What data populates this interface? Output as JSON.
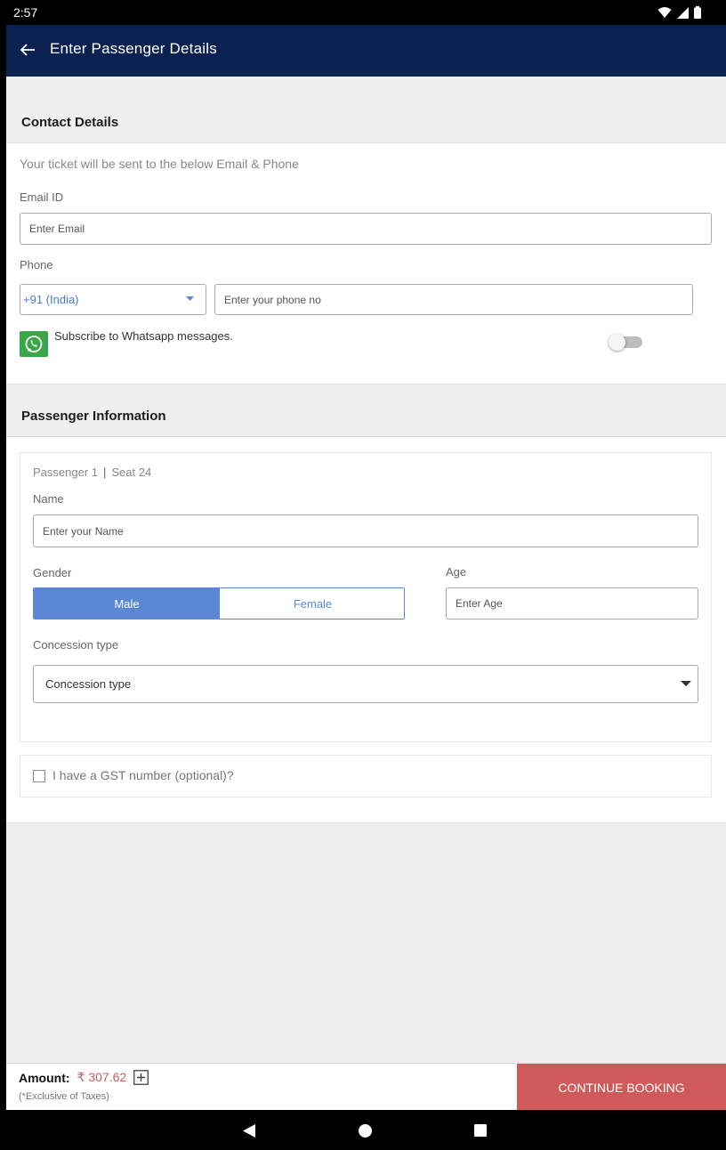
{
  "status_bar": {
    "time": "2:57"
  },
  "toolbar": {
    "title": "Enter Passenger Details"
  },
  "contact": {
    "heading": "Contact Details",
    "info": "Your ticket will be sent to the below Email & Phone",
    "email_label": "Email ID",
    "email_placeholder": "Enter Email",
    "phone_label": "Phone",
    "country_code": "+91 (India)",
    "phone_placeholder": "Enter your phone no",
    "whatsapp_label": "Subscribe to Whatsapp messages.",
    "whatsapp_enabled": false
  },
  "passenger": {
    "heading": "Passenger Information",
    "passenger_no": "Passenger 1",
    "separator": "|",
    "seat": "Seat 24",
    "name_label": "Name",
    "name_placeholder": "Enter your Name",
    "gender_label": "Gender",
    "gender_options": [
      "Male",
      "Female"
    ],
    "gender_selected": "Male",
    "age_label": "Age",
    "age_placeholder": "Enter Age",
    "concession_label": "Concession type",
    "concession_value": "Concession type"
  },
  "gst": {
    "label": "I have a GST number (optional)?"
  },
  "footer": {
    "amount_label": "Amount:",
    "amount_value": "₹ 307.62",
    "tax_note": "(*Exclusive of Taxes)",
    "cta": "CONTINUE BOOKING"
  },
  "colors": {
    "toolbar": "#0b2250",
    "accent_blue": "#5b87d6",
    "cta": "#d05a5a",
    "whatsapp": "#3aa64a"
  }
}
